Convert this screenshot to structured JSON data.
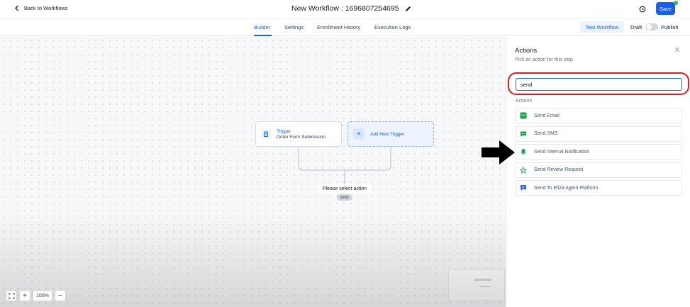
{
  "header": {
    "back_label": "Back to Workflows",
    "workflow_title": "New Workflow : 1696807254695",
    "save_label": "Save"
  },
  "tabs": [
    {
      "label": "Builder",
      "active": true
    },
    {
      "label": "Settings",
      "active": false
    },
    {
      "label": "Enrollment History",
      "active": false
    },
    {
      "label": "Execution Logs",
      "active": false
    }
  ],
  "toolbar_right": {
    "test_label": "Test Workflow",
    "draft_label": "Draft",
    "publish_label": "Publish",
    "published": false
  },
  "canvas": {
    "trigger_node": {
      "title": "Trigger",
      "subtitle": "Order Form Submission"
    },
    "add_trigger_label": "Add New Trigger",
    "select_action_label": "Please select action",
    "end_label": "END",
    "zoom_level": "100%"
  },
  "panel": {
    "title": "Actions",
    "subtitle": "Pick an action for this step",
    "search_value": "send",
    "section_label": "Actions",
    "actions": [
      {
        "label": "Send Email",
        "icon": "email-icon",
        "color": "#16a34a"
      },
      {
        "label": "Send SMS",
        "icon": "sms-icon",
        "color": "#16a34a"
      },
      {
        "label": "Send Internal Notification",
        "icon": "bell-icon",
        "color": "#16a34a"
      },
      {
        "label": "Send Review Request",
        "icon": "star-icon",
        "color": "#16a34a"
      },
      {
        "label": "Send To Eliza Agent Platform",
        "icon": "chat-icon",
        "color": "#2563eb"
      }
    ]
  },
  "colors": {
    "accent": "#155eef",
    "highlight_ring": "#e11d1d",
    "status_dot": "#22c55e"
  }
}
